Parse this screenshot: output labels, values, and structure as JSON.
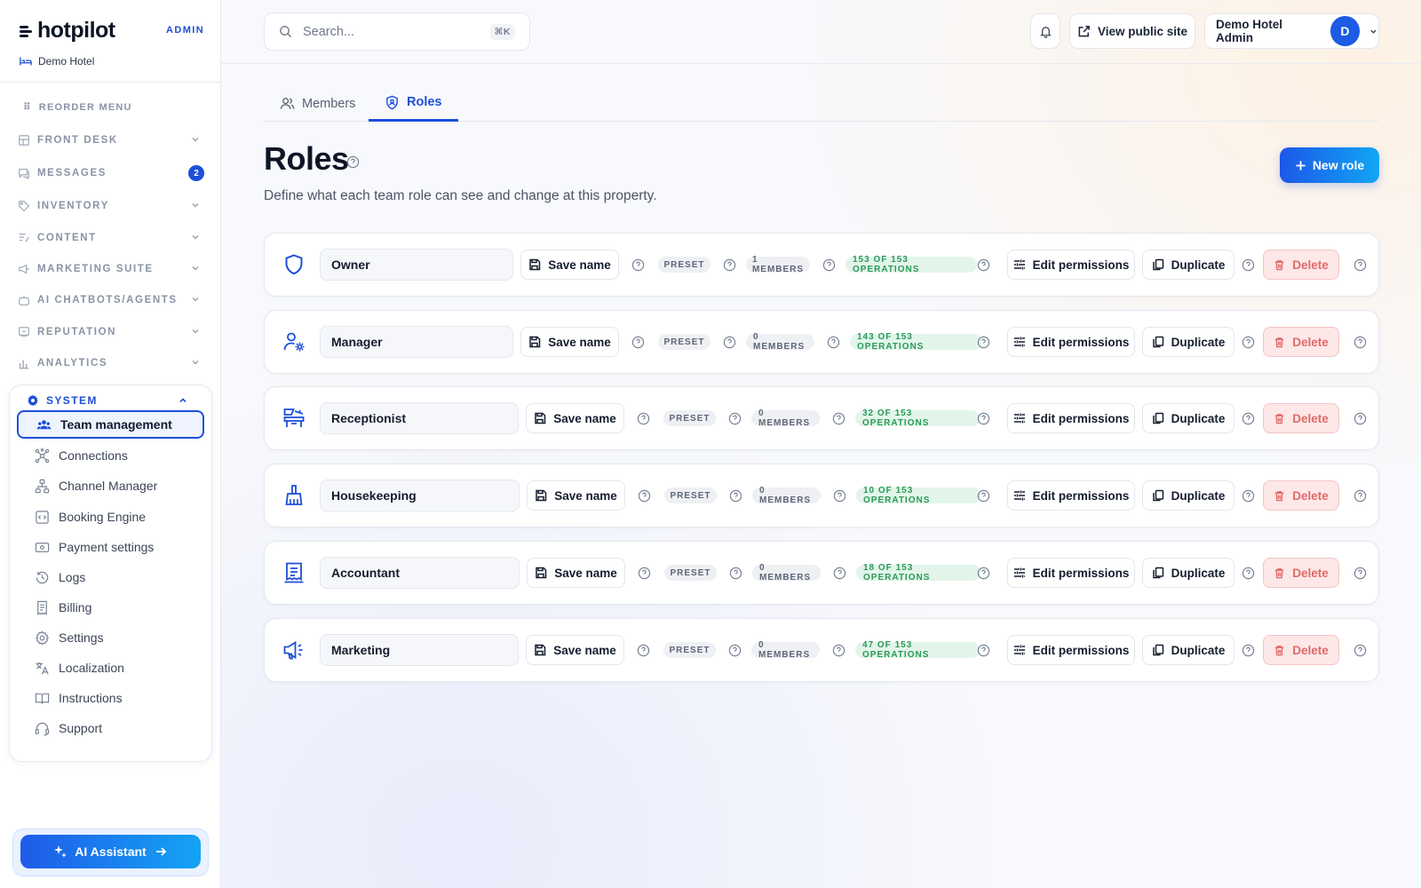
{
  "brand": {
    "name": "hotpilot",
    "tag": "ADMIN",
    "hotel": "Demo Hotel"
  },
  "sidebar": {
    "reorder_label": "REORDER MENU",
    "sections": [
      {
        "label": "FRONT DESK",
        "icon": "front-desk-icon"
      },
      {
        "label": "MESSAGES",
        "icon": "messages-icon",
        "badge": "2"
      },
      {
        "label": "INVENTORY",
        "icon": "tag-icon"
      },
      {
        "label": "CONTENT",
        "icon": "content-icon"
      },
      {
        "label": "MARKETING SUITE",
        "icon": "megaphone-icon"
      },
      {
        "label": "AI CHATBOTS/AGENTS",
        "icon": "robot-icon"
      },
      {
        "label": "REPUTATION",
        "icon": "reputation-icon"
      },
      {
        "label": "ANALYTICS",
        "icon": "analytics-icon"
      }
    ],
    "system": {
      "label": "SYSTEM",
      "items": [
        {
          "label": "Team management",
          "icon": "team-icon",
          "active": true
        },
        {
          "label": "Connections",
          "icon": "connections-icon"
        },
        {
          "label": "Channel Manager",
          "icon": "channel-manager-icon"
        },
        {
          "label": "Booking Engine",
          "icon": "booking-engine-icon"
        },
        {
          "label": "Payment settings",
          "icon": "payment-icon"
        },
        {
          "label": "Logs",
          "icon": "logs-icon"
        },
        {
          "label": "Billing",
          "icon": "billing-icon"
        },
        {
          "label": "Settings",
          "icon": "gear-icon"
        },
        {
          "label": "Localization",
          "icon": "translate-icon"
        },
        {
          "label": "Instructions",
          "icon": "book-icon"
        },
        {
          "label": "Support",
          "icon": "headset-icon"
        }
      ]
    },
    "ai_assistant": "AI Assistant"
  },
  "topbar": {
    "search_placeholder": "Search...",
    "search_shortcut": "⌘K",
    "view_public_site": "View public site",
    "user_name": "Demo Hotel Admin",
    "user_initial": "D"
  },
  "tabs": [
    {
      "label": "Members",
      "active": false
    },
    {
      "label": "Roles",
      "active": true
    }
  ],
  "page": {
    "title": "Roles",
    "subtitle": "Define what each team role can see and change at this property.",
    "new_role_label": "New role"
  },
  "role_actions": {
    "save_name": "Save name",
    "preset": "PRESET",
    "edit_permissions": "Edit permissions",
    "duplicate": "Duplicate",
    "delete": "Delete"
  },
  "roles": [
    {
      "name": "Owner",
      "icon": "shield-icon",
      "members": "1 MEMBERS",
      "operations": "153 OF 153 OPERATIONS"
    },
    {
      "name": "Manager",
      "icon": "user-gear-icon",
      "members": "0 MEMBERS",
      "operations": "143 OF 153 OPERATIONS"
    },
    {
      "name": "Receptionist",
      "icon": "reception-desk-icon",
      "members": "0 MEMBERS",
      "operations": "32 OF 153 OPERATIONS"
    },
    {
      "name": "Housekeeping",
      "icon": "broom-icon",
      "members": "0 MEMBERS",
      "operations": "10 OF 153 OPERATIONS"
    },
    {
      "name": "Accountant",
      "icon": "ledger-icon",
      "members": "0 MEMBERS",
      "operations": "18 OF 153 OPERATIONS"
    },
    {
      "name": "Marketing",
      "icon": "megaphone-icon",
      "members": "0 MEMBERS",
      "operations": "47 OF 153 OPERATIONS"
    }
  ],
  "colors": {
    "accent": "#1d4fd8",
    "success": "#2a9a58",
    "danger": "#e06a6a"
  }
}
